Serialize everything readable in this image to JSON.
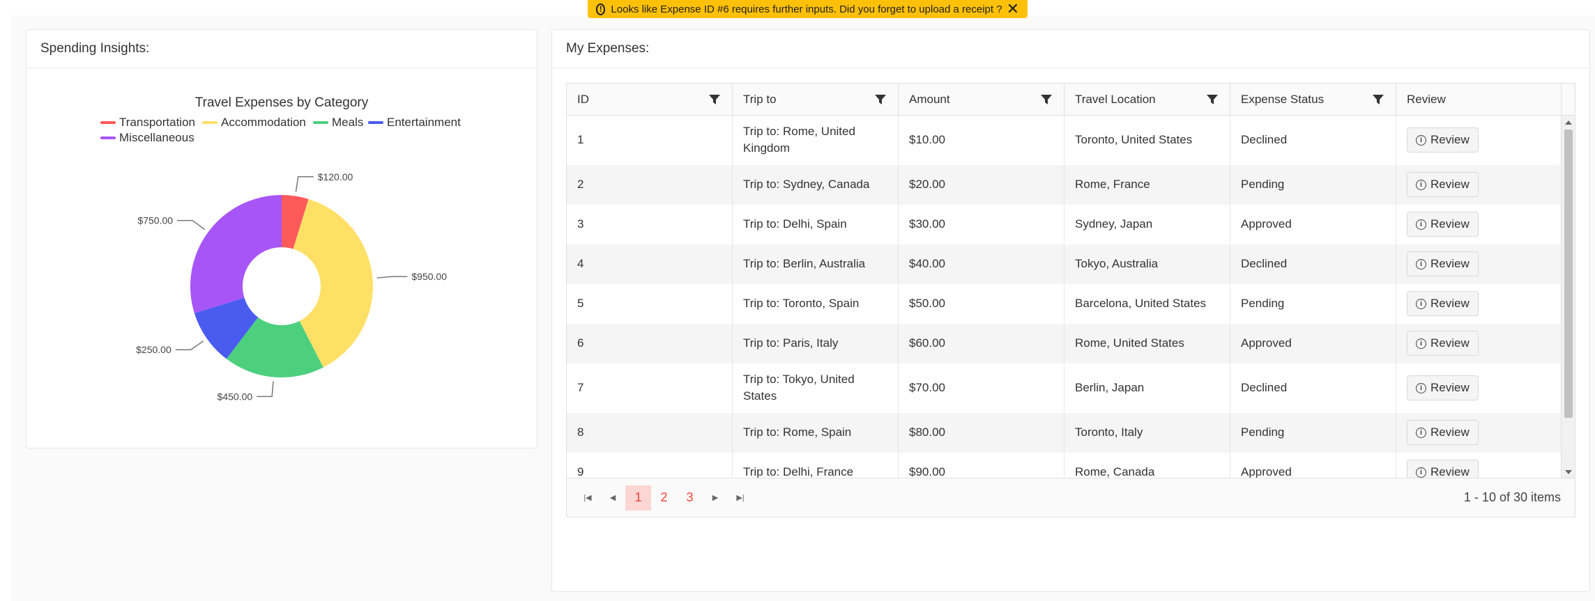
{
  "toast": {
    "message": "Looks like Expense ID #6 requires further inputs. Did you forget to upload a receipt ?",
    "icon": "exclamation-circle-icon",
    "close_glyph": "✕",
    "color": "#ffc107"
  },
  "insights": {
    "title": "Spending Insights:"
  },
  "chart_data": {
    "type": "pie",
    "donut": true,
    "title": "Travel Expenses by Category",
    "legend_placement": "top",
    "categories": [
      "Transportation",
      "Accommodation",
      "Meals",
      "Entertainment",
      "Miscellaneous"
    ],
    "values": [
      120,
      950,
      450,
      250,
      750
    ],
    "data_labels": [
      "$120.00",
      "$950.00",
      "$450.00",
      "$250.00",
      "$750.00"
    ],
    "colors": [
      "#ff5a5a",
      "#ffe066",
      "#4cd07d",
      "#4a5cf0",
      "#a855f7"
    ]
  },
  "expenses": {
    "title": "My Expenses:",
    "columns": [
      "ID",
      "Trip to",
      "Amount",
      "Travel Location",
      "Expense Status",
      "Review"
    ],
    "review_label": "Review",
    "rows": [
      {
        "id": "1",
        "trip": "Trip to: Rome, United Kingdom",
        "amount": "$10.00",
        "location": "Toronto, United States",
        "status": "Declined"
      },
      {
        "id": "2",
        "trip": "Trip to: Sydney, Canada",
        "amount": "$20.00",
        "location": "Rome, France",
        "status": "Pending"
      },
      {
        "id": "3",
        "trip": "Trip to: Delhi, Spain",
        "amount": "$30.00",
        "location": "Sydney, Japan",
        "status": "Approved"
      },
      {
        "id": "4",
        "trip": "Trip to: Berlin, Australia",
        "amount": "$40.00",
        "location": "Tokyo, Australia",
        "status": "Declined"
      },
      {
        "id": "5",
        "trip": "Trip to: Toronto, Spain",
        "amount": "$50.00",
        "location": "Barcelona, United States",
        "status": "Pending"
      },
      {
        "id": "6",
        "trip": "Trip to: Paris, Italy",
        "amount": "$60.00",
        "location": "Rome, United States",
        "status": "Approved"
      },
      {
        "id": "7",
        "trip": "Trip to: Tokyo, United States",
        "amount": "$70.00",
        "location": "Berlin, Japan",
        "status": "Declined"
      },
      {
        "id": "8",
        "trip": "Trip to: Rome, Spain",
        "amount": "$80.00",
        "location": "Toronto, Italy",
        "status": "Pending"
      },
      {
        "id": "9",
        "trip": "Trip to: Delhi, France",
        "amount": "$90.00",
        "location": "Rome, Canada",
        "status": "Approved"
      }
    ],
    "pager": {
      "pages": [
        "1",
        "2",
        "3"
      ],
      "current_page": "1",
      "info": "1 - 10 of 30 items"
    }
  }
}
